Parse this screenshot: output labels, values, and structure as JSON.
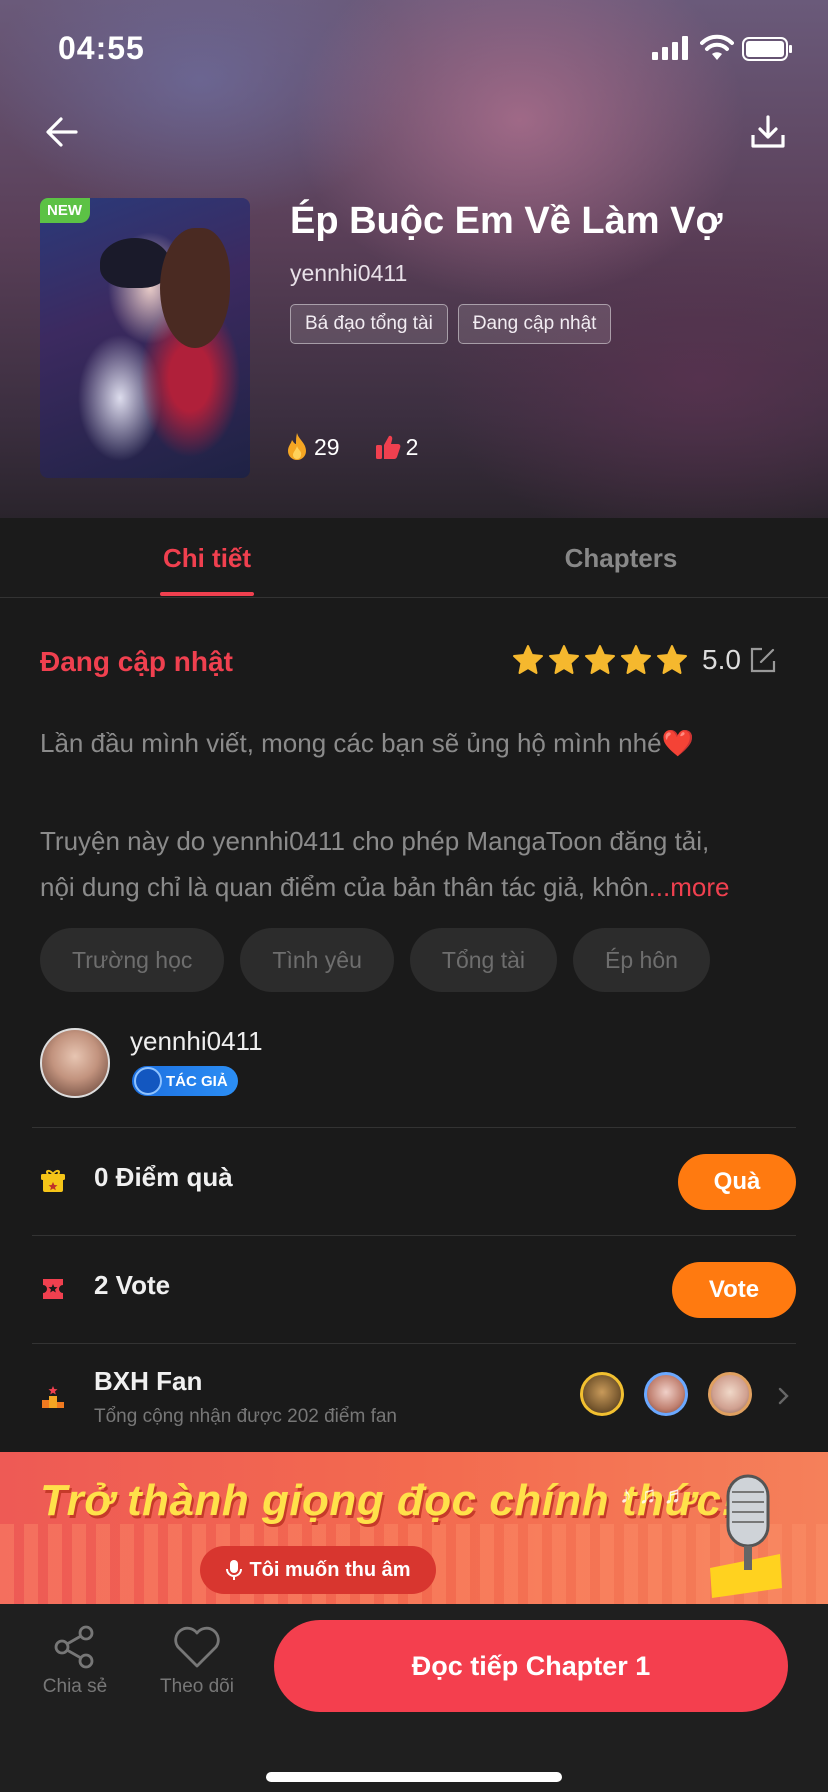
{
  "status_bar": {
    "time": "04:55"
  },
  "book": {
    "badge": "NEW",
    "title": "Ép Buộc Em Về Làm Vợ",
    "author": "yennhi0411",
    "genre_tags": [
      "Bá đạo tổng tài",
      "Đang cập nhật"
    ],
    "fire_count": "29",
    "like_count": "2"
  },
  "tabs": {
    "detail": "Chi tiết",
    "chapters": "Chapters"
  },
  "detail": {
    "status": "Đang cập nhật",
    "rating": "5.0",
    "desc_line1": "Lần đầu mình viết, mong các bạn sẽ ủng hộ mình nhé❤️",
    "desc_line2": "Truyện này do yennhi0411 cho phép MangaToon đăng tải,",
    "desc_line3": "nội dung chỉ là quan điểm của bản thân tác giả, khôn",
    "more": "...more",
    "tags": [
      "Trường học",
      "Tình yêu",
      "Tổng tài",
      "Ép hôn"
    ],
    "author_name": "yennhi0411",
    "author_badge": "TÁC GIẢ"
  },
  "gift_row": {
    "label": "0 Điểm quà",
    "button": "Quà"
  },
  "vote_row": {
    "label": "2 Vote",
    "button": "Vote"
  },
  "fan_row": {
    "label": "BXH Fan",
    "sub": "Tổng cộng nhận được 202 điểm fan"
  },
  "banner": {
    "title": "Trở thành giọng đọc chính thức!",
    "button": "Tôi muốn thu âm"
  },
  "bottom": {
    "share": "Chia sẻ",
    "follow": "Theo dõi",
    "read": "Đọc tiếp Chapter 1"
  },
  "colors": {
    "accent": "#f0404f",
    "orange": "#ff7a10",
    "star": "#f5b82e"
  },
  "icons": [
    "back-arrow-icon",
    "download-icon",
    "fire-icon",
    "thumb-up-icon",
    "star-icon",
    "edit-icon",
    "gift-icon",
    "ticket-icon",
    "podium-icon",
    "chevron-right-icon",
    "microphone-icon",
    "share-icon",
    "heart-icon"
  ]
}
